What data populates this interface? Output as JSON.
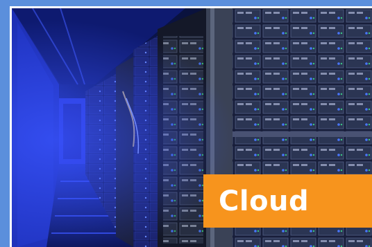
{
  "banner": {
    "label": "Cloud",
    "label_bg_color": "#f7941d",
    "border_color": "#5b8fdc",
    "photo_subject": "server-racks-data-center-corridor",
    "accent_light_color": "#3b5cff"
  }
}
